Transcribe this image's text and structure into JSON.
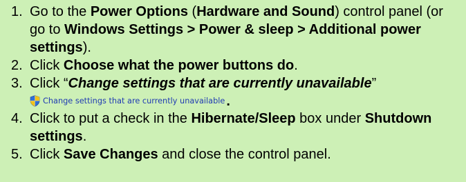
{
  "steps": [
    {
      "number": "1.",
      "segments": [
        {
          "text": "Go to the ",
          "bold": false
        },
        {
          "text": "Power Options",
          "bold": true
        },
        {
          "text": " (",
          "bold": false
        },
        {
          "text": "Hardware and Sound",
          "bold": true
        },
        {
          "text": ") control panel (or go to ",
          "bold": false
        },
        {
          "text": "Windows Settings > Power & sleep > Additional power settings",
          "bold": true
        },
        {
          "text": ").",
          "bold": false
        }
      ]
    },
    {
      "number": "2.",
      "segments": [
        {
          "text": "Click ",
          "bold": false
        },
        {
          "text": "Choose what the power buttons do",
          "bold": true
        },
        {
          "text": ".",
          "bold": false
        }
      ]
    },
    {
      "number": "3.",
      "segments": [
        {
          "text": "Click “",
          "bold": false
        },
        {
          "text": "Change settings that are currently unavailable",
          "bold": true,
          "italic": true
        },
        {
          "text": "”",
          "bold": false
        }
      ],
      "link": {
        "icon": "uac-shield-icon",
        "label": "Change settings that are currently unavailable",
        "trailing": "."
      }
    },
    {
      "number": "4.",
      "segments": [
        {
          "text": "Click to put a check in the ",
          "bold": false
        },
        {
          "text": "Hibernate/Sleep",
          "bold": true
        },
        {
          "text": " box under ",
          "bold": false
        },
        {
          "text": "Shutdown settings",
          "bold": true
        },
        {
          "text": ".",
          "bold": false
        }
      ]
    },
    {
      "number": "5.",
      "segments": [
        {
          "text": "Click ",
          "bold": false
        },
        {
          "text": "Save Changes",
          "bold": true
        },
        {
          "text": " and close the control panel.",
          "bold": false
        }
      ]
    }
  ],
  "colors": {
    "background": "#cdf0b6",
    "link": "#1f3ab3"
  }
}
